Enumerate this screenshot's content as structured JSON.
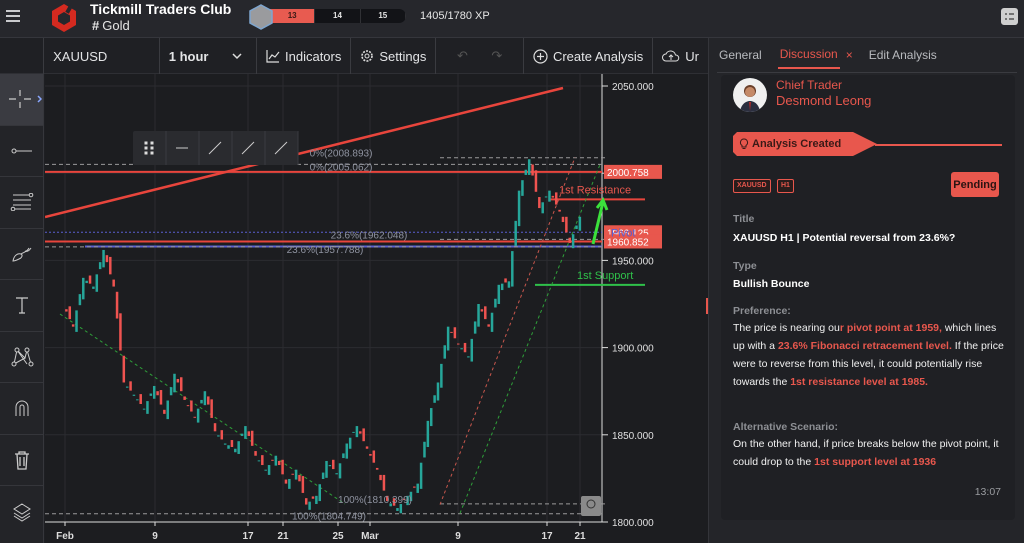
{
  "app": {
    "title": "Tickmill Traders Club",
    "channel": "Gold",
    "channel_prefix": "#"
  },
  "xp": {
    "levels": [
      "13",
      "14",
      "15"
    ],
    "current_level": "13",
    "progress_text": "1405/1780 XP",
    "current": 1405,
    "max": 1780
  },
  "toolbar": {
    "symbol": "XAUUSD",
    "timeframe": "1 hour",
    "indicators": "Indicators",
    "settings": "Settings",
    "create_analysis": "Create Analysis",
    "upload": "Ur"
  },
  "left_tools": [
    "crosshair-icon",
    "horizontal-line-icon",
    "fib-lines-icon",
    "brush-icon",
    "text-icon",
    "pattern-icon",
    "magnet-icon",
    "trash-icon",
    "layers-icon"
  ],
  "drawing_toolbar": [
    "drag-handle-icon",
    "ray-icon",
    "segment-icon",
    "line-icon",
    "extended-line-icon"
  ],
  "chart_data": {
    "type": "candlestick",
    "symbol": "XAUUSD",
    "timeframe": "H1",
    "y_ticks": [
      "2050.000",
      "2000.000",
      "1950.000",
      "1900.000",
      "1850.000",
      "1800.000"
    ],
    "ylim": [
      1800,
      2050
    ],
    "x_ticks": [
      "Feb",
      "9",
      "17",
      "21",
      "25",
      "Mar",
      "9",
      "17",
      "21"
    ],
    "price_labels": [
      {
        "text": "2000.758",
        "value": 2000.758,
        "color": "#e8574d"
      },
      {
        "text": "1966.125",
        "value": 1966.125,
        "color": "#e8574d"
      },
      {
        "text": "1960.852",
        "value": 1960.852,
        "color": "#e8574d"
      }
    ],
    "fib_labels": [
      {
        "text": "0%(2008.893)",
        "value": 2008.893
      },
      {
        "text": "0%(2005.062)",
        "value": 2005.062
      },
      {
        "text": "23.6%(1962.048)",
        "value": 1962.048
      },
      {
        "text": "23.6%(1957.788)",
        "value": 1957.788
      },
      {
        "text": "100%(1810.399)",
        "value": 1810.399
      },
      {
        "text": "100%(1804.749)",
        "value": 1804.749
      }
    ],
    "annotations": [
      {
        "text": "1st Resistance",
        "value": 1985,
        "color": "#e8574d"
      },
      {
        "text": "Pivot",
        "value": 1966,
        "color": "#5a5fd1"
      },
      {
        "text": "1st Support",
        "value": 1936,
        "color": "#2fc14a"
      }
    ],
    "price_path": [
      1925,
      1912,
      1940,
      1935,
      1956,
      1935,
      1880,
      1873,
      1865,
      1878,
      1862,
      1885,
      1870,
      1860,
      1875,
      1852,
      1845,
      1842,
      1855,
      1838,
      1830,
      1838,
      1822,
      1830,
      1810,
      1815,
      1835,
      1828,
      1845,
      1855,
      1842,
      1830,
      1812,
      1808,
      1815,
      1822,
      1858,
      1880,
      1912,
      1902,
      1895,
      1925,
      1912,
      1936,
      1938,
      1990,
      2008,
      1980,
      1990,
      1978,
      1960,
      1975
    ]
  },
  "panel": {
    "tabs": [
      "General",
      "Discussion",
      "Edit Analysis"
    ],
    "active_tab": "Discussion",
    "author_role": "Chief Trader",
    "author_name": "Desmond Leong",
    "status_banner": "Analysis Created",
    "tags": [
      "XAUUSD",
      "H1"
    ],
    "status": "Pending",
    "title_label": "Title",
    "title": "XAUUSD H1 | Potential reversal from 23.6%?",
    "type_label": "Type",
    "type": "Bullish Bounce",
    "preference_label": "Preference:",
    "preference": [
      {
        "t": "The price is nearing ou",
        "h": false
      },
      {
        "t": "r pivot point at 1959,",
        "h": true
      },
      {
        "t": " which lines up with a ",
        "h": false
      },
      {
        "t": "23.6% Fibonacci retracement level.",
        "h": true
      },
      {
        "t": " If the price were to reverse from this level, it could potentially rise towards the ",
        "h": false
      },
      {
        "t": "1st resistance level at 1985.",
        "h": true
      }
    ],
    "alt_label": "Alternative Scenario:",
    "alternative": [
      {
        "t": "On the other hand, if price breaks below the pivot point, it could drop to the ",
        "h": false
      },
      {
        "t": "1st support level at 1936",
        "h": true
      }
    ],
    "time": "13:07"
  }
}
